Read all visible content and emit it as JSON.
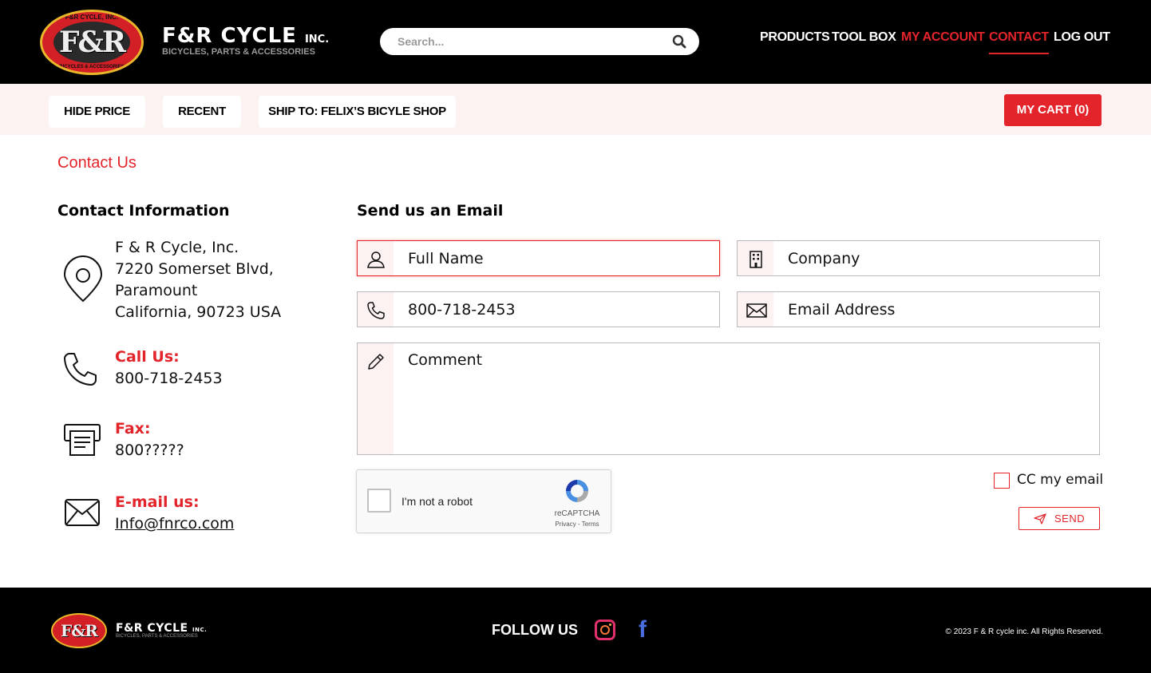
{
  "brand": {
    "badge_mono": "F&R",
    "badge_ring_top": "F&R CYCLE, INC.",
    "badge_ring_bottom": "BICYCLES & ACCESSORIES",
    "wordmark": "F&R CYCLE",
    "wordmark_suffix": "INC.",
    "tagline": "BICYCLES, PARTS & ACCESSORIES"
  },
  "search": {
    "placeholder": "Search..."
  },
  "nav": {
    "products": "PRODUCTS",
    "toolbox": "TOOL BOX",
    "account": "MY ACCOUNT",
    "contact": "CONTACT",
    "logout": "LOG OUT"
  },
  "subbar": {
    "hide_price": "HIDE PRICE",
    "recent": "RECENT",
    "ship_to": "SHIP TO: FELIX’S BICYLE SHOP",
    "cart": "MY CART (0)"
  },
  "page": {
    "breadcrumb": "Contact Us",
    "contact_heading": "Contact Information",
    "email_heading": "Send us an Email"
  },
  "contact": {
    "address_lines": [
      "F & R Cycle, Inc.",
      "7220 Somerset Blvd,",
      "Paramount",
      "California, 90723 USA"
    ],
    "call_label": "Call Us:",
    "call_value": "800-718-2453",
    "fax_label": "Fax:",
    "fax_value": "800?????",
    "email_label": "E-mail us:",
    "email_value": "Info@fnrco.com"
  },
  "form": {
    "full_name_placeholder": "Full Name",
    "company_placeholder": "Company",
    "phone_value": "800-718-2453",
    "email_placeholder": "Email Address",
    "comment_placeholder": "Comment",
    "captcha_label": "I'm not a robot",
    "captcha_brand": "reCAPTCHA",
    "captcha_terms": "Privacy - Terms",
    "cc_label": "CC my email",
    "send_label": "SEND"
  },
  "footer": {
    "badge_mono": "F&R",
    "wordmark": "F&R CYCLE",
    "wordmark_suffix": "INC.",
    "tagline": "BICYCLES, PARTS & ACCESSORIES",
    "follow": "FOLLOW US",
    "facebook_glyph": "f",
    "copyright": "© 2023 F & R cycle inc. All Rights Reserved."
  },
  "colors": {
    "accent": "#e3242b",
    "header_bg": "#000000",
    "subbar_bg": "#fdf2f2"
  },
  "icons": [
    "search-icon",
    "location-pin-icon",
    "phone-icon",
    "fax-icon",
    "mail-icon",
    "user-icon",
    "building-icon",
    "pencil-icon",
    "send-icon",
    "instagram-icon",
    "facebook-icon"
  ]
}
